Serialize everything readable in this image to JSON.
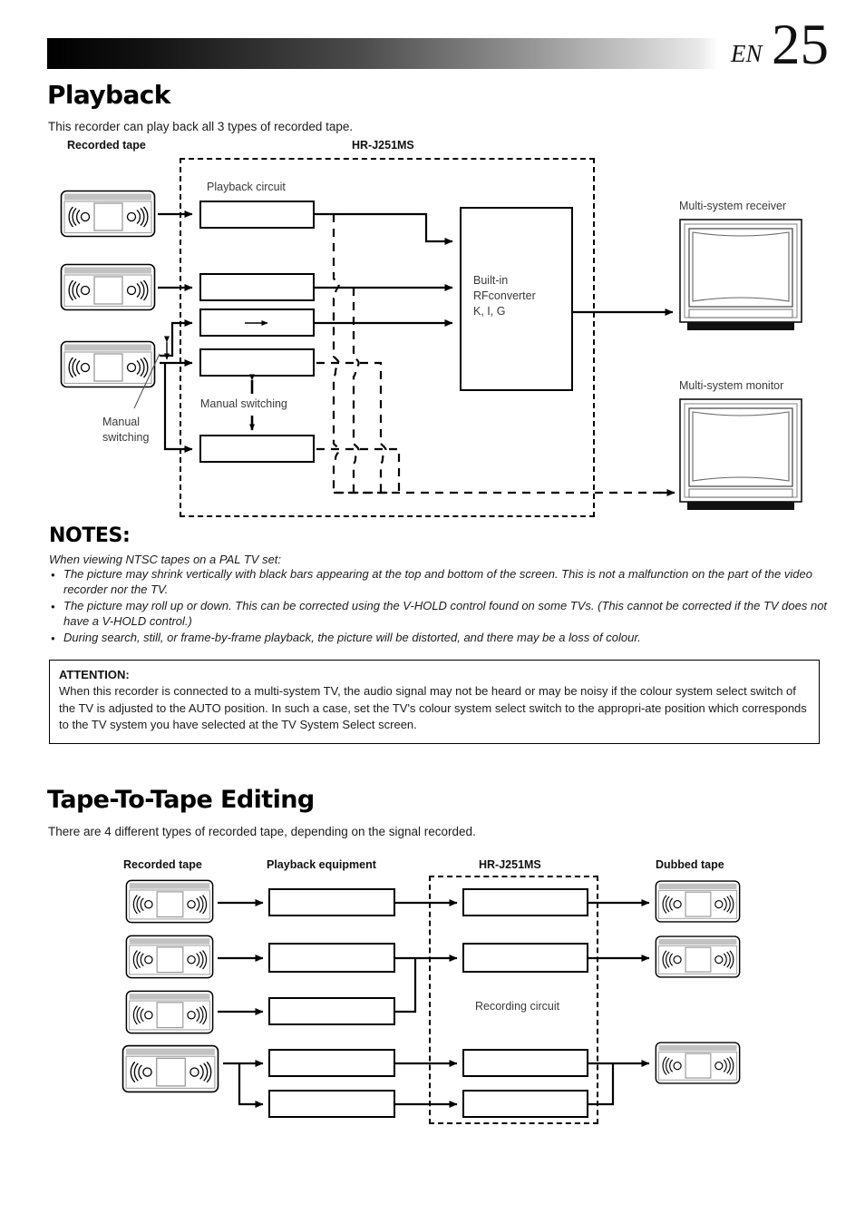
{
  "header": {
    "lang_code": "EN",
    "page_number": "25"
  },
  "section1": {
    "title": "Playback",
    "intro": "This recorder can play back all 3 types of recorded tape.",
    "col_label_left": "Recorded tape",
    "col_label_center": "HR-J251MS",
    "playback_circuit_label": "Playback circuit",
    "manual_switching_left": "Manual\nswitching",
    "manual_switching_center": "Manual switching",
    "rf_converter_label": "Built-in\nRFconverter\nK, I, G",
    "receiver_label": "Multi-system receiver",
    "monitor_label": "Multi-system monitor"
  },
  "notes": {
    "title": "NOTES:",
    "lead": "When viewing NTSC tapes on a PAL TV set:",
    "items": [
      "The picture may shrink vertically with black bars appearing at the top and bottom of the screen. This is not a malfunction on the part of the video recorder nor the TV.",
      "The picture may roll up or down. This can be corrected using the V-HOLD control found on some TVs. (This cannot be corrected if the TV does not have a V-HOLD control.)",
      "During search, still, or frame-by-frame playback, the picture will be distorted, and there may be a loss of colour."
    ],
    "attention_title": "ATTENTION:",
    "attention_body": "When this recorder is connected to a multi-system TV, the audio signal may not be heard or may be noisy if the colour system select switch of the TV is adjusted to the AUTO position. In such a case, set the TV's colour system select switch to the appropri-ate position which corresponds to the TV system you have selected at the TV System Select screen."
  },
  "section2": {
    "title": "Tape-To-Tape Editing",
    "intro": "There are 4 different types of recorded tape, depending on the signal recorded.",
    "col_label_1": "Recorded tape",
    "col_label_2": "Playback equipment",
    "col_label_3": "HR-J251MS",
    "col_label_4": "Dubbed tape",
    "recording_circuit_label": "Recording circuit"
  },
  "colors": {
    "ink": "#000000",
    "text": "#1b1b1b",
    "tape_frame": "#9a9a9a",
    "tape_band": "#bdbdbd"
  }
}
